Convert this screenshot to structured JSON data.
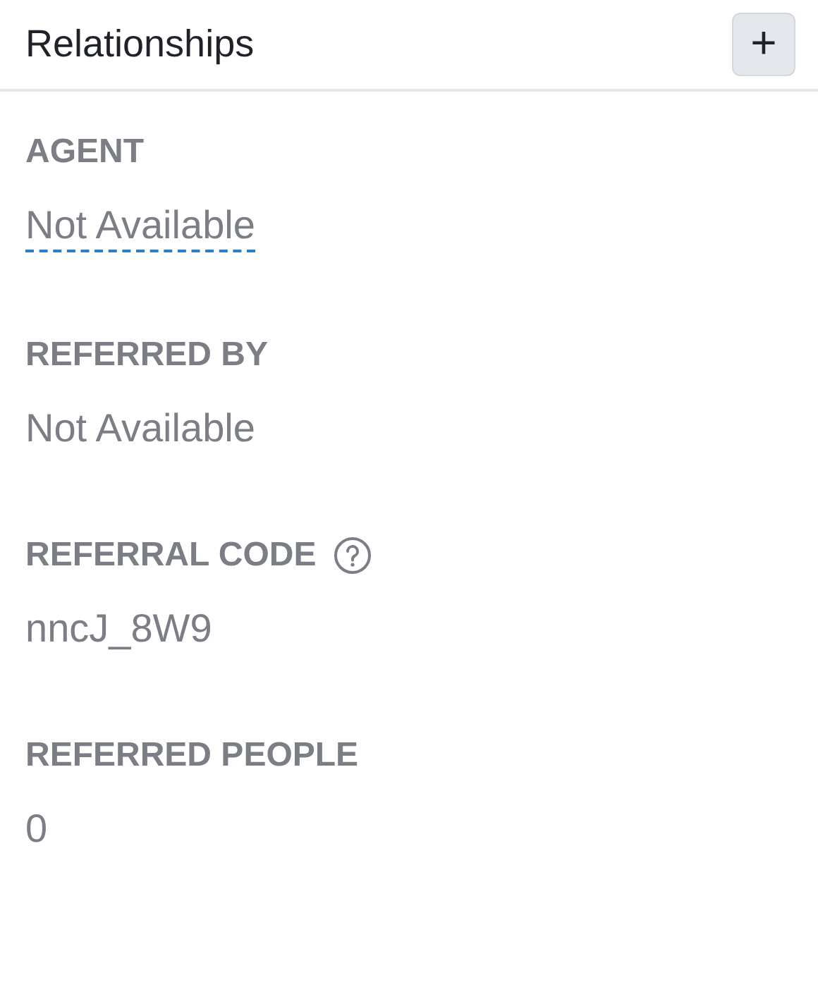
{
  "header": {
    "title": "Relationships",
    "add_button": "+"
  },
  "fields": [
    {
      "label": "AGENT",
      "value": "Not Available",
      "kind": "link",
      "help": false
    },
    {
      "label": "REFERRED BY",
      "value": "Not Available",
      "kind": "text",
      "help": false
    },
    {
      "label": "REFERRAL CODE",
      "value": "nncJ_8W9",
      "kind": "text",
      "help": true
    },
    {
      "label": "REFERRED PEOPLE",
      "value": "0",
      "kind": "text",
      "help": false
    }
  ]
}
